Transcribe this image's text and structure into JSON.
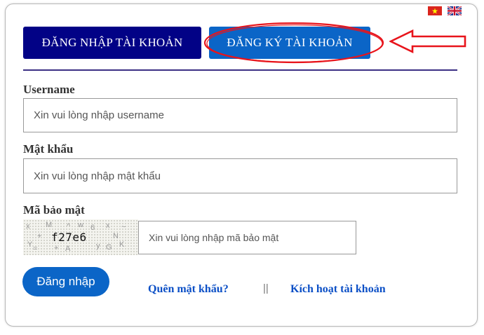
{
  "tabs": {
    "login": "ĐĂNG NHẬP TÀI KHOẢN",
    "register": "ĐĂNG KÝ TÀI KHOẢN"
  },
  "languages": [
    "vietnamese-flag-icon",
    "uk-flag-icon"
  ],
  "form": {
    "username_label": "Username",
    "username_placeholder": "Xin vui lòng nhập username",
    "password_label": "Mật khẩu",
    "password_placeholder": "Xin vui lòng nhập mật khẩu",
    "captcha_label": "Mã bảo mật",
    "captcha_text": "f27e6",
    "captcha_placeholder": "Xin vui lòng nhập mã bảo mật",
    "submit_label": "Đăng nhập"
  },
  "links": {
    "forgot_password": "Quên mật khẩu?",
    "separator": "||",
    "activate_account": "Kích hoạt tài khoản"
  },
  "colors": {
    "login_tab": "#020286",
    "register_tab": "#0b65c7",
    "annotation": "#e8141b",
    "link": "#0b4fc6"
  }
}
